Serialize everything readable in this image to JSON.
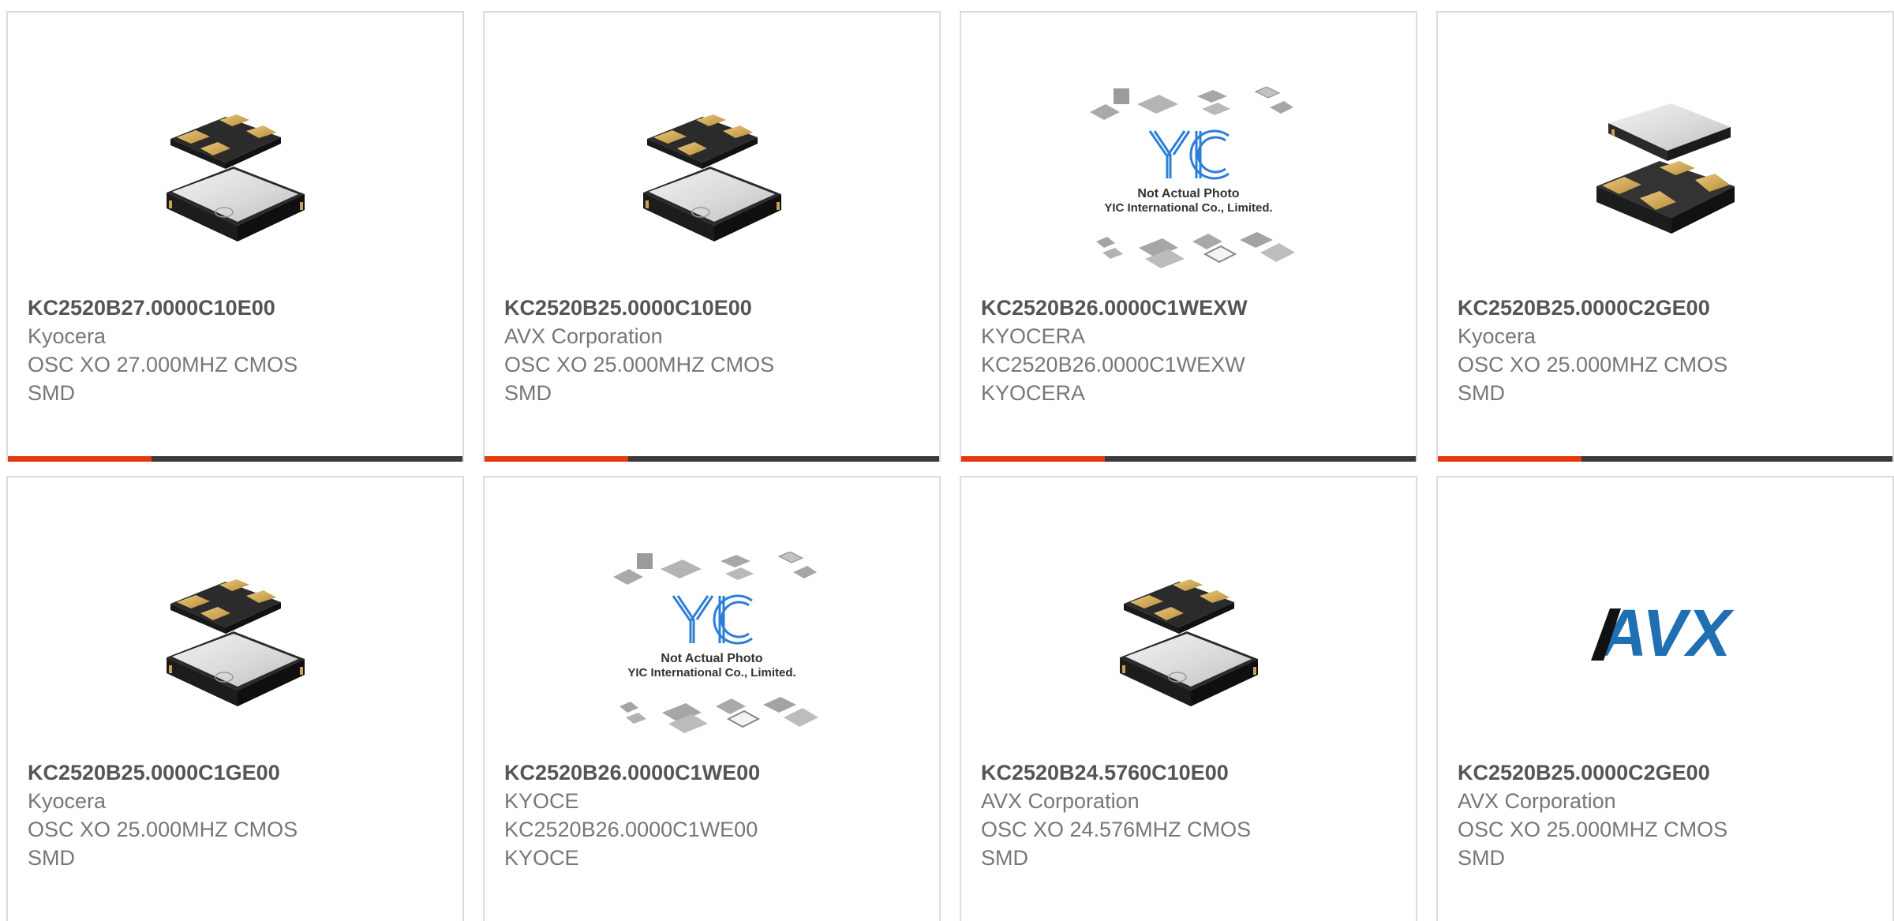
{
  "accent_color": "#e8380d",
  "bar_color": "#3a3a3a",
  "placeholder": {
    "line1": "Not Actual Photo",
    "line2": "YIC International Co., Limited.",
    "logo_text": "YIC"
  },
  "avx_logo_text": "AVX",
  "products": [
    {
      "part": "KC2520B27.0000C10E00",
      "manufacturer": "Kyocera",
      "desc1": "OSC XO 27.000MHZ CMOS",
      "desc2": "SMD",
      "image": "crystal-top-pads-icon"
    },
    {
      "part": "KC2520B25.0000C10E00",
      "manufacturer": "AVX Corporation",
      "desc1": "OSC XO 25.000MHZ CMOS",
      "desc2": "SMD",
      "image": "crystal-top-pads-icon"
    },
    {
      "part": "KC2520B26.0000C1WEXW",
      "manufacturer": "KYOCERA",
      "desc1": "KC2520B26.0000C1WEXW",
      "desc2": "KYOCERA",
      "image": "not-actual-photo-placeholder"
    },
    {
      "part": "KC2520B25.0000C2GE00",
      "manufacturer": "Kyocera",
      "desc1": "OSC XO 25.000MHZ CMOS",
      "desc2": "SMD",
      "image": "crystal-bottom-pads-icon"
    },
    {
      "part": "KC2520B25.0000C1GE00",
      "manufacturer": "Kyocera",
      "desc1": "OSC XO 25.000MHZ CMOS",
      "desc2": "SMD",
      "image": "crystal-top-pads-icon"
    },
    {
      "part": "KC2520B26.0000C1WE00",
      "manufacturer": "KYOCE",
      "desc1": "KC2520B26.0000C1WE00",
      "desc2": "KYOCE",
      "image": "not-actual-photo-placeholder"
    },
    {
      "part": "KC2520B24.5760C10E00",
      "manufacturer": "AVX Corporation",
      "desc1": "OSC XO 24.576MHZ CMOS",
      "desc2": "SMD",
      "image": "crystal-top-pads-icon"
    },
    {
      "part": "KC2520B25.0000C2GE00",
      "manufacturer": "AVX Corporation",
      "desc1": "OSC XO 25.000MHZ CMOS",
      "desc2": "SMD",
      "image": "avx-logo"
    }
  ]
}
